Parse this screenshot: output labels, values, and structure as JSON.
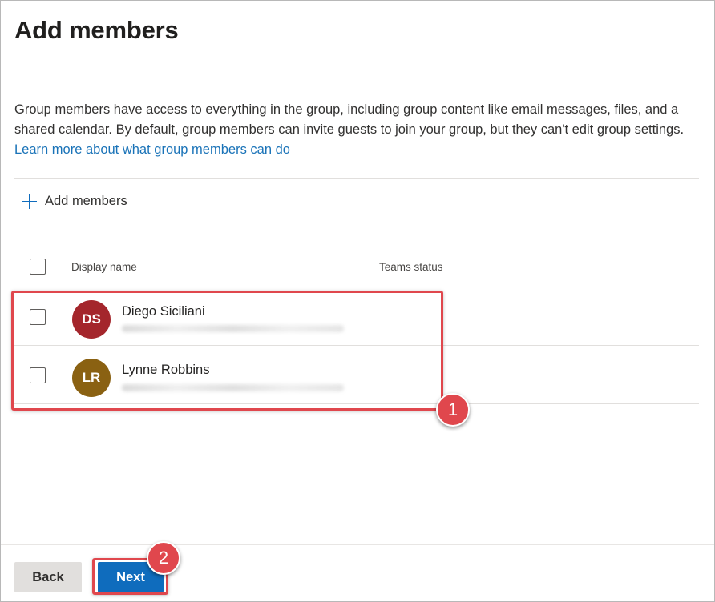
{
  "page": {
    "title": "Add members",
    "description": "Group members have access to everything in the group, including group content like email messages, files, and a shared calendar. By default, group members can invite guests to join your group, but they can't edit group settings.",
    "learn_more_link": "Learn more about what group members can do"
  },
  "toolbar": {
    "add_members_label": "Add members",
    "add_icon": "plus-icon"
  },
  "table": {
    "columns": [
      "Display name",
      "Teams status"
    ],
    "rows": [
      {
        "initials": "DS",
        "name": "Diego Siciliani",
        "avatar_color": "#a4262c",
        "teams_status": ""
      },
      {
        "initials": "LR",
        "name": "Lynne Robbins",
        "avatar_color": "#8a6112",
        "teams_status": ""
      }
    ]
  },
  "annotations": {
    "callout_1": "1",
    "callout_2": "2",
    "color": "#e0474d"
  },
  "footer": {
    "back_label": "Back",
    "next_label": "Next"
  },
  "colors": {
    "accent": "#0f6cbd",
    "link": "#1a73b8"
  }
}
